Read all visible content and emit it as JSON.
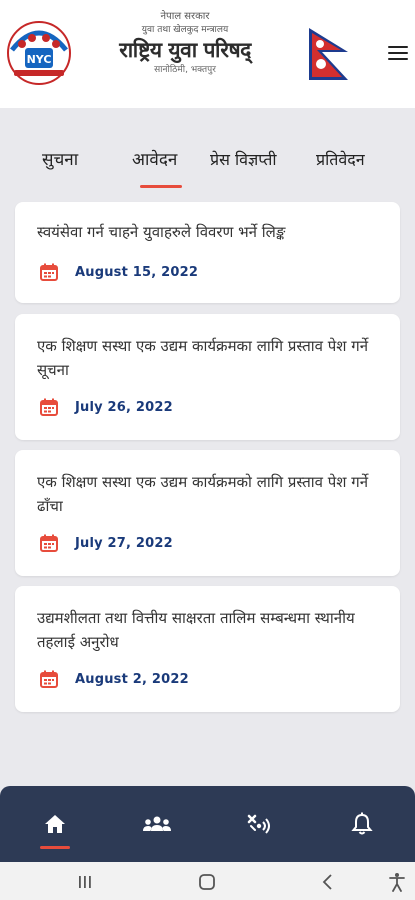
{
  "header": {
    "government": "नेपाल सरकार",
    "ministry": "युवा तथा खेलकुद मन्त्रालय",
    "council_name": "राष्ट्रिय युवा परिषद्",
    "address": "सानोठिमी, भक्तपुर",
    "logo_text": "NYC"
  },
  "tabs": [
    {
      "label": "सुचना"
    },
    {
      "label": "आवेदन",
      "active": true
    },
    {
      "label": "प्रेस विज्ञप्ती"
    },
    {
      "label": "प्रतिवेदन"
    }
  ],
  "notices": [
    {
      "title": "स्वयंसेवा गर्न चाहने युवाहरुले विवरण भर्ने लिङ्क",
      "date": "August 15, 2022"
    },
    {
      "title": "एक शिक्षण सस्था एक उद्यम कार्यक्रमका लागि प्रस्ताव पेश गर्ने सूचना",
      "date": "July 26, 2022"
    },
    {
      "title": "एक शिक्षण सस्था एक उद्यम कार्यक्रमको लागि प्रस्ताव पेश गर्ने ढाँचा",
      "date": "July 27, 2022"
    },
    {
      "title": "उद्यमशीलता तथा वित्तीय साक्षरता तालिम सम्बन्धमा स्थानीय तहलाई अनुरोध",
      "date": "August 2, 2022"
    }
  ],
  "bottom_nav": [
    {
      "icon": "home-icon",
      "active": true
    },
    {
      "icon": "group-icon"
    },
    {
      "icon": "network-icon"
    },
    {
      "icon": "bell-icon"
    }
  ],
  "colors": {
    "accent": "#e74c3c",
    "nav_bg": "#2d3a55",
    "date_text": "#1a3a7a",
    "page_bg": "#e9e9ed"
  }
}
